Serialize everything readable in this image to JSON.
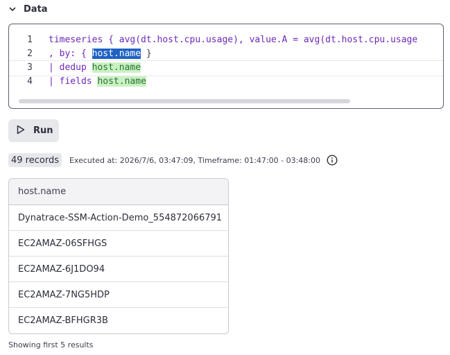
{
  "section": {
    "title": "Data"
  },
  "editor": {
    "lines": [
      {
        "number": "1",
        "text": "timeseries { avg(dt.host.cpu.usage), value.A = avg(dt.host.cpu.usage"
      },
      {
        "number": "2",
        "prefix": ", by: { ",
        "selected": "host.name",
        "suffix": " }"
      },
      {
        "number": "3",
        "prefix": "| dedup ",
        "highlight": "host.name"
      },
      {
        "number": "4",
        "prefix": "| fields ",
        "highlight": "host.name"
      }
    ]
  },
  "toolbar": {
    "run_label": "Run"
  },
  "result": {
    "records": "49 records",
    "executed": "Executed at: 2026/7/6, 03:47:09, Timeframe: 01:47:00 - 03:48:00"
  },
  "table": {
    "header": "host.name",
    "rows": [
      "Dynatrace-SSM-Action-Demo_554872066791",
      "EC2AMAZ-06SFHGS",
      "EC2AMAZ-6J1DO94",
      "EC2AMAZ-7NG5HDP",
      "EC2AMAZ-BFHGR3B"
    ]
  },
  "footer": {
    "text": "Showing first 5 results"
  }
}
